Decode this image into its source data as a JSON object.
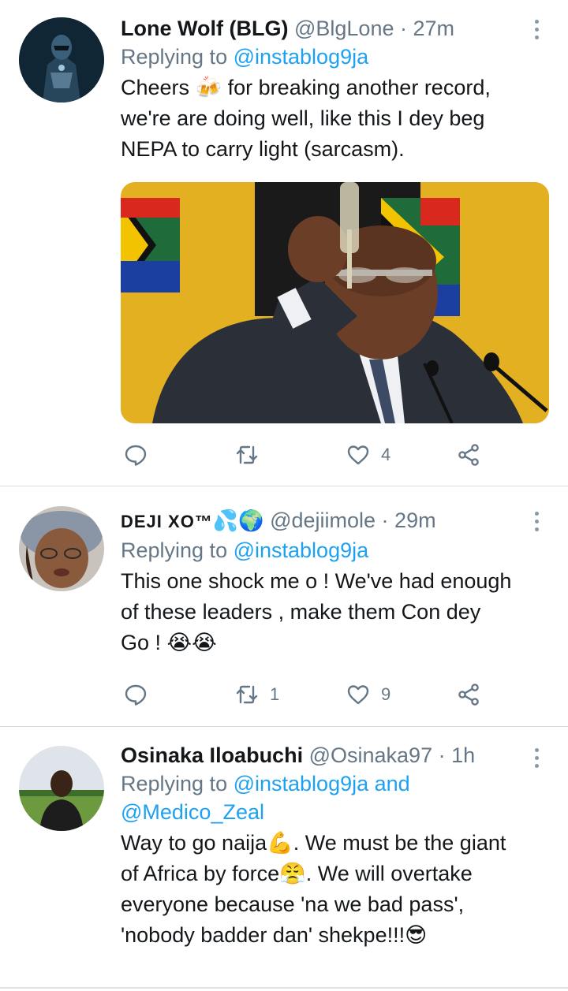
{
  "tweets": [
    {
      "name": "Lone Wolf (BLG)",
      "handle": "@BlgLone",
      "time": "27m",
      "replying_prefix": "Replying to ",
      "replying_to": "@instablog9ja",
      "text_lines": [
        "Cheers 🍻 for breaking another record,",
        "we're are doing well, like this I dey beg",
        "NEPA to carry light (sarcasm)."
      ],
      "likes": "4",
      "retweets": ""
    },
    {
      "name": "DEJI XO™",
      "name_emojis": "💦🌍",
      "handle": "@dejiimole",
      "time": "29m",
      "replying_prefix": "Replying to ",
      "replying_to": "@instablog9ja",
      "text_lines": [
        "This one shock me o ! We've had enough",
        "of these leaders , make them Con dey",
        "Go ! 😭😭"
      ],
      "retweets": "1",
      "likes": "9"
    },
    {
      "name": "Osinaka Iloabuchi",
      "handle": "@Osinaka97",
      "time": "1h",
      "replying_prefix": "Replying to ",
      "replying_to": "@instablog9ja and",
      "replying_to_2": "@Medico_Zeal",
      "text_lines": [
        "Way to go naija💪.  We must be the giant",
        "of Africa by force😤.  We will overtake",
        "everyone because 'na we bad pass',",
        "'nobody badder dan' shekpe!!!😎"
      ]
    }
  ],
  "separator": " · ",
  "colors": {
    "accent": "#1da1f2",
    "muted": "#657786",
    "text": "#14171a"
  },
  "icons": [
    "reply-icon",
    "retweet-icon",
    "like-icon",
    "share-icon",
    "more-icon"
  ]
}
